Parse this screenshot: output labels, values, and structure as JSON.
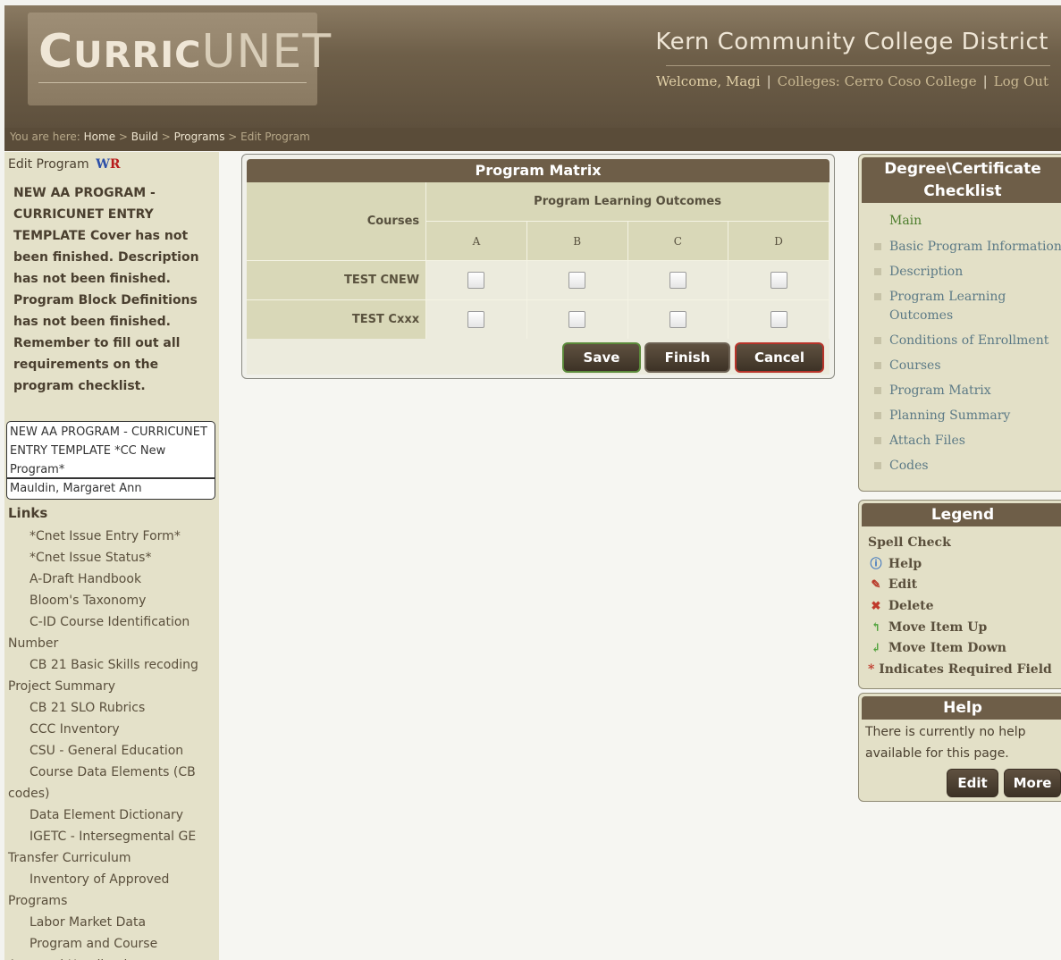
{
  "header": {
    "logo": "CurricUNET",
    "district": "Kern Community College District",
    "welcome": "Welcome, Magi",
    "colleges": "Colleges: Cerro Coso College",
    "logout": "Log Out"
  },
  "breadcrumb": {
    "prefix": "You are here:",
    "items": [
      "Home",
      "Build",
      "Programs"
    ],
    "current": "Edit Program"
  },
  "left": {
    "title": "Edit Program",
    "status_text": "NEW AA PROGRAM - CURRICUNET ENTRY TEMPLATE Cover has not been finished. Description has not been finished. Program Block Definitions has not been finished. Remember to fill out all requirements on the program checklist.",
    "program_name": "NEW AA PROGRAM - CURRICUNET ENTRY TEMPLATE *CC New Program*",
    "owner": "Mauldin, Margaret Ann",
    "links_title": "Links",
    "links": [
      "*Cnet Issue Entry Form*",
      "*Cnet Issue Status*",
      "A-Draft Handbook",
      "Bloom's Taxonomy",
      "C-ID Course Identification Number",
      "CB 21 Basic Skills recoding Project Summary",
      "CB 21 SLO Rubrics",
      "CCC Inventory",
      "CSU - General Education",
      "Course Data Elements (CB codes)",
      "Data Element Dictionary",
      "IGETC - Intersegmental GE Transfer Curriculum",
      "Inventory of Approved Programs",
      "Labor Market Data",
      "Program and Course Approval Handbook"
    ]
  },
  "matrix": {
    "title": "Program Matrix",
    "courses_header": "Courses",
    "plo_header": "Program Learning Outcomes",
    "outcomes": [
      "A",
      "B",
      "C",
      "D"
    ],
    "rows": [
      {
        "course": "TEST CNEW",
        "checked": [
          false,
          false,
          false,
          false
        ]
      },
      {
        "course": "TEST Cxxx",
        "checked": [
          false,
          false,
          false,
          false
        ]
      }
    ],
    "buttons": {
      "save": "Save",
      "finish": "Finish",
      "cancel": "Cancel"
    }
  },
  "checklist": {
    "title_line1": "Degree\\Certificate",
    "title_line2": "Checklist",
    "main": "Main",
    "items": [
      "Basic Program Information",
      "Description",
      "Program Learning Outcomes",
      "Conditions of Enrollment",
      "Courses",
      "Program Matrix",
      "Planning Summary",
      "Attach Files",
      "Codes"
    ]
  },
  "legend": {
    "title": "Legend",
    "items": [
      {
        "icon": "spell-check-icon",
        "label": "Spell Check"
      },
      {
        "icon": "help-icon",
        "label": "Help"
      },
      {
        "icon": "edit-icon",
        "label": "Edit"
      },
      {
        "icon": "delete-icon",
        "label": "Delete"
      },
      {
        "icon": "move-up-icon",
        "label": "Move Item Up"
      },
      {
        "icon": "move-down-icon",
        "label": "Move Item Down"
      },
      {
        "icon": "required-icon",
        "label": "Indicates Required Field"
      }
    ]
  },
  "help": {
    "title": "Help",
    "text": "There is currently no help available for this page.",
    "edit": "Edit",
    "more": "More"
  }
}
